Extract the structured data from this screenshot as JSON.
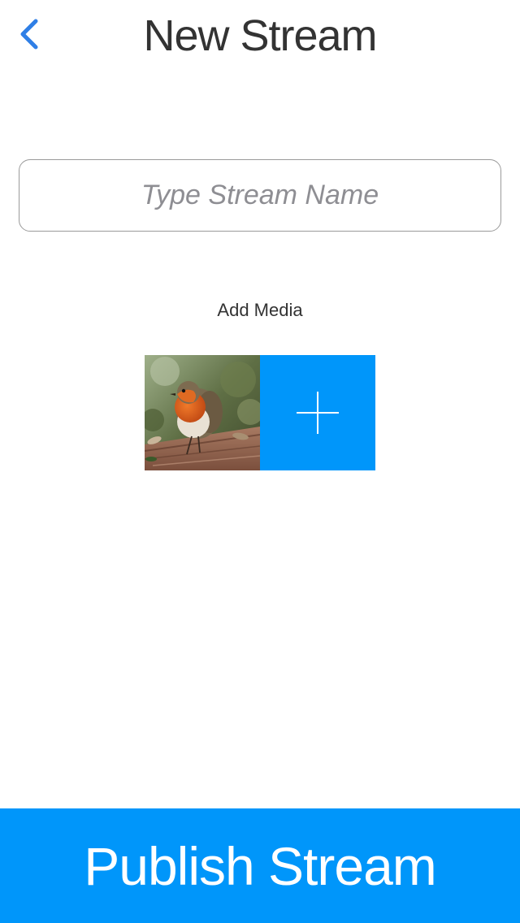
{
  "header": {
    "title": "New Stream",
    "back_icon": "chevron-left-icon"
  },
  "stream_name": {
    "value": "",
    "placeholder": "Type Stream Name"
  },
  "media": {
    "label": "Add Media",
    "items": [
      {
        "description": "robin-bird-photo"
      }
    ],
    "add_icon": "plus-icon"
  },
  "footer": {
    "publish_label": "Publish Stream"
  },
  "colors": {
    "accent": "#0096fa",
    "back_chevron": "#2f7fe6",
    "title": "#333333",
    "placeholder": "#8e8e93"
  }
}
